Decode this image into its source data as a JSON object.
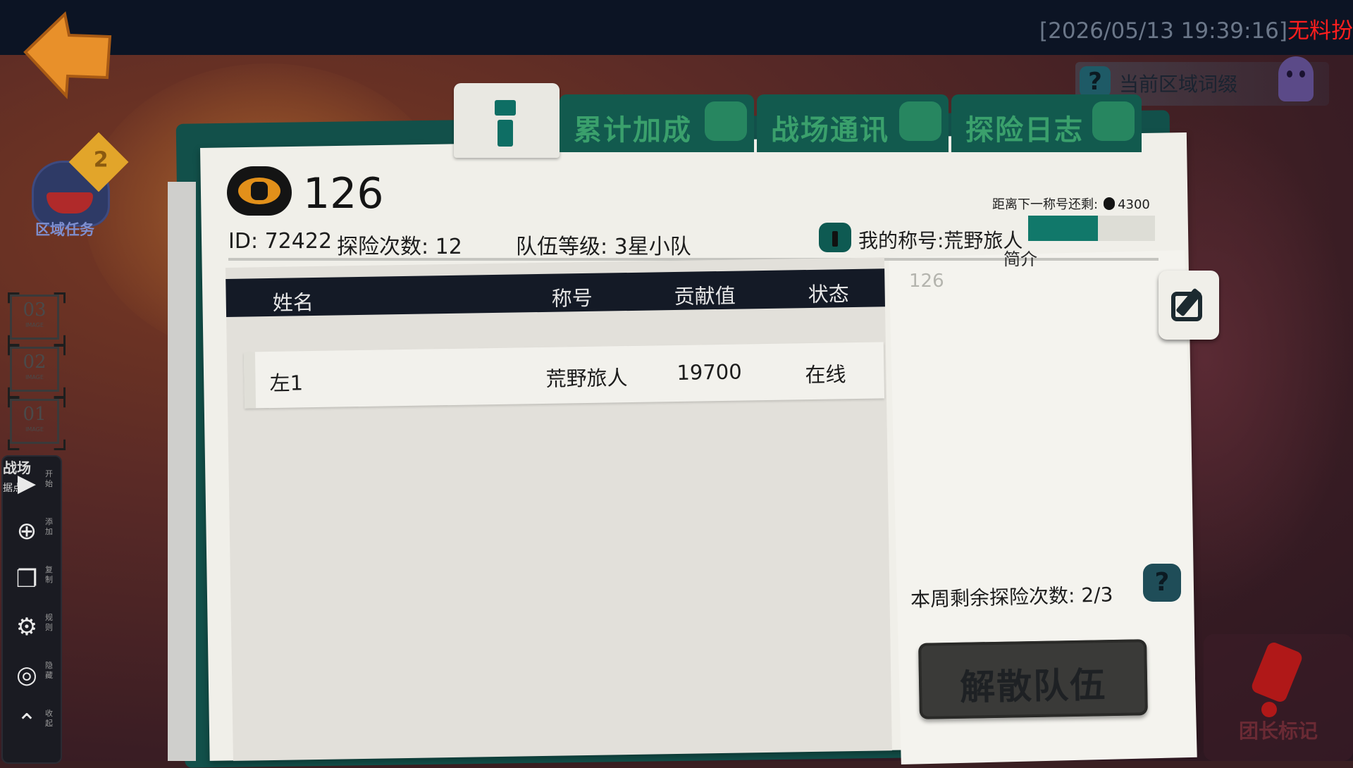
{
  "topbar": {
    "timestamp": "[2026/05/13 19:39:16]",
    "timestamp_suffix": "无料扮"
  },
  "zone_prefix": {
    "help_icon": "question-icon",
    "label": "当前区域词缀"
  },
  "zone_task": {
    "badge": "2",
    "label": "区域任务"
  },
  "image_slots": [
    {
      "num": "03",
      "sub": "IMAGE"
    },
    {
      "num": "02",
      "sub": "IMAGE"
    },
    {
      "num": "01",
      "sub": "IMAGE"
    }
  ],
  "toolbar": {
    "tag_top": "战场",
    "tag_sub": "据点",
    "items": [
      {
        "icon": "play-icon",
        "label": "开始"
      },
      {
        "icon": "add-icon",
        "label": "添加"
      },
      {
        "icon": "copy-icon",
        "label": "复制"
      },
      {
        "icon": "settings-icon",
        "label": "规则"
      },
      {
        "icon": "hide-icon",
        "label": "隐藏"
      },
      {
        "icon": "collapse-icon",
        "label": "收起"
      }
    ]
  },
  "tabs": [
    {
      "label": "累计加成",
      "icon": "skull-icon"
    },
    {
      "label": "战场通讯",
      "icon": "chat-icon"
    },
    {
      "label": "探险日志",
      "icon": "pencil-icon"
    }
  ],
  "team": {
    "name": "126",
    "id_text": "ID: 72422",
    "explore_count_text": "探险次数: 12",
    "level_text": "队伍等级: 3星小队",
    "next_title_text": "距离下一称号还剩:",
    "next_title_value": "4300",
    "my_title_text": "我的称号:荒野旅人",
    "title_progress": 0.55,
    "intro_label": "简介",
    "intro_text": "126"
  },
  "members_table": {
    "headers": {
      "name": "姓名",
      "title": "称号",
      "contribution": "贡献值",
      "status": "状态"
    },
    "rows": [
      {
        "name": "左1",
        "title": "荒野旅人",
        "contribution": "19700",
        "status": "在线"
      }
    ]
  },
  "weekly": {
    "label": "本周剩余探险次数:",
    "value": "2/3"
  },
  "disband_label": "解散队伍",
  "leader_mark_label": "团长标记",
  "colors": {
    "accent_teal": "#0e6e64",
    "timestamp_red": "#ff1e1e",
    "coin_orange": "#e2901a"
  }
}
